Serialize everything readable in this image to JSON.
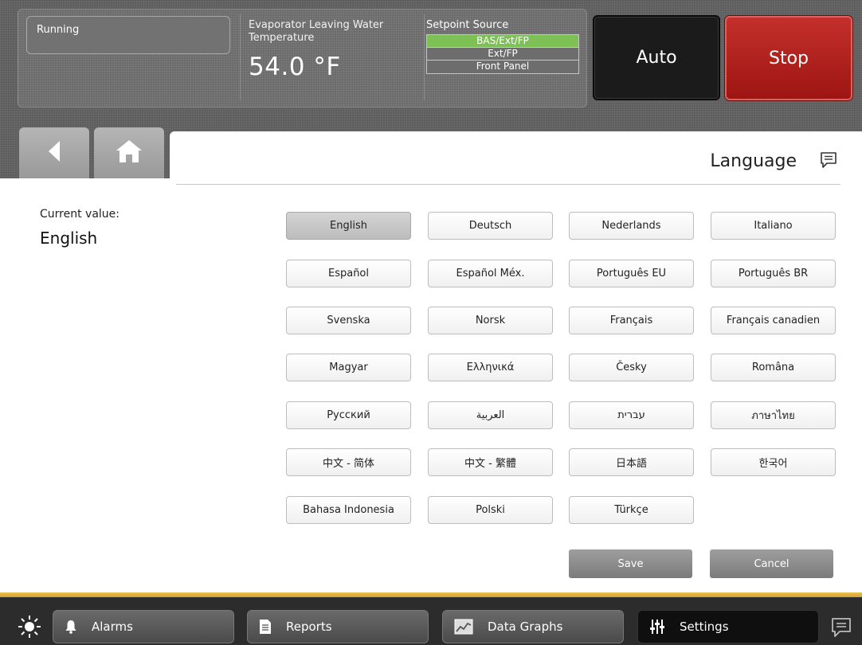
{
  "header": {
    "state": "Running",
    "evap_label": "Evaporator Leaving Water Temperature",
    "evap_value": "54.0 °F",
    "setpoint_label": "Setpoint Source",
    "setpoint_options": [
      "BAS/Ext/FP",
      "Ext/FP",
      "Front Panel"
    ],
    "setpoint_active": "BAS/Ext/FP",
    "auto_label": "Auto",
    "stop_label": "Stop"
  },
  "nav": {
    "back_icon": "arrow-left-icon",
    "home_icon": "home-icon"
  },
  "page": {
    "title": "Language",
    "current_label": "Current value:",
    "current_value": "English",
    "languages": [
      "English",
      "Deutsch",
      "Nederlands",
      "Italiano",
      "Español",
      "Español Méx.",
      "Português EU",
      "Português BR",
      "Svenska",
      "Norsk",
      "Français",
      "Français canadien",
      "Magyar",
      "Ελληνικά",
      "Česky",
      "Româna",
      "Русский",
      "العربية",
      "עברית",
      "ภาษาไทย",
      "中文 - 简体",
      "中文 - 繁體",
      "日本語",
      "한국어",
      "Bahasa Indonesia",
      "Polski",
      "Türkçe"
    ],
    "selected_language": "English",
    "save_label": "Save",
    "cancel_label": "Cancel"
  },
  "bottom": {
    "alarms": "Alarms",
    "reports": "Reports",
    "data_graphs": "Data Graphs",
    "settings": "Settings",
    "active_tab": "Settings"
  },
  "colors": {
    "active_setpoint": "#7dc055",
    "stop": "#b0201c",
    "accent_bar": "#e0b444"
  }
}
